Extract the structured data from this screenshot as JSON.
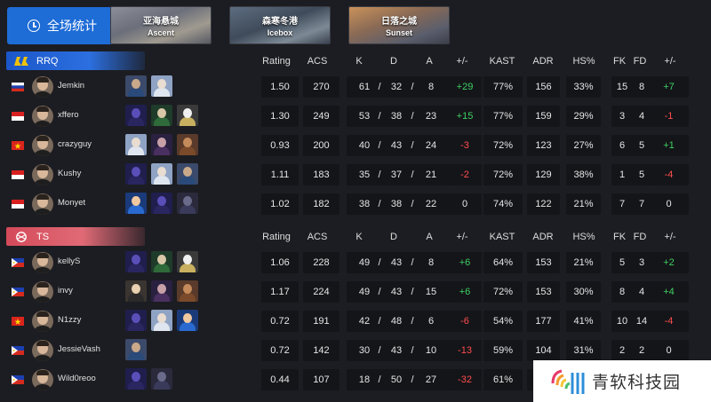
{
  "all_stats_label": "全场统计",
  "maps": [
    {
      "cn": "亚海悬城",
      "en": "Ascent"
    },
    {
      "cn": "森寒冬港",
      "en": "Icebox"
    },
    {
      "cn": "日落之城",
      "en": "Sunset"
    }
  ],
  "columns": [
    "Rating",
    "ACS",
    "K",
    "D",
    "A",
    "+/-",
    "KAST",
    "ADR",
    "HS%",
    "FK",
    "FD",
    "+/-"
  ],
  "teams": [
    {
      "name": "RRQ",
      "accent": "#2c6fe0",
      "players": [
        {
          "name": "Jemkin",
          "flag": "ru",
          "agents": [
            "sova",
            "jett"
          ],
          "rating": "1.50",
          "acs": "270",
          "k": "61",
          "d": "32",
          "a": "8",
          "kd_diff": "+29",
          "kast": "77%",
          "adr": "156",
          "hs": "33%",
          "fk": "15",
          "fd": "8",
          "fk_diff": "+7"
        },
        {
          "name": "xffero",
          "flag": "id",
          "agents": [
            "omen",
            "viper",
            "killjoy"
          ],
          "rating": "1.30",
          "acs": "249",
          "k": "53",
          "d": "38",
          "a": "23",
          "kd_diff": "+15",
          "kast": "77%",
          "adr": "159",
          "hs": "29%",
          "fk": "3",
          "fk_diff": "-1",
          "fd": "4"
        },
        {
          "name": "crazyguy",
          "flag": "vn",
          "agents": [
            "jett",
            "reyna",
            "breach"
          ],
          "rating": "0.93",
          "acs": "200",
          "k": "40",
          "d": "43",
          "a": "24",
          "kd_diff": "-3",
          "kast": "72%",
          "adr": "123",
          "hs": "27%",
          "fk": "6",
          "fd": "5",
          "fk_diff": "+1"
        },
        {
          "name": "Kushy",
          "flag": "id",
          "agents": [
            "omen",
            "jett",
            "sova"
          ],
          "rating": "1.11",
          "acs": "183",
          "k": "35",
          "d": "37",
          "a": "21",
          "kd_diff": "-2",
          "kast": "72%",
          "adr": "129",
          "hs": "38%",
          "fk": "1",
          "fd": "5",
          "fk_diff": "-4"
        },
        {
          "name": "Monyet",
          "flag": "id",
          "agents": [
            "neon",
            "omen",
            "omen2"
          ],
          "rating": "1.02",
          "acs": "182",
          "k": "38",
          "d": "38",
          "a": "22",
          "kd_diff": "0",
          "kast": "74%",
          "adr": "122",
          "hs": "21%",
          "fk": "7",
          "fd": "7",
          "fk_diff": "0"
        }
      ]
    },
    {
      "name": "TS",
      "accent": "#e06a76",
      "players": [
        {
          "name": "kellyS",
          "flag": "ph",
          "agents": [
            "omen",
            "viper",
            "killjoy"
          ],
          "rating": "1.06",
          "acs": "228",
          "k": "49",
          "d": "43",
          "a": "8",
          "kd_diff": "+6",
          "kast": "64%",
          "adr": "153",
          "hs": "21%",
          "fk": "5",
          "fd": "3",
          "fk_diff": "+2"
        },
        {
          "name": "invy",
          "flag": "ph",
          "agents": [
            "chamber",
            "reyna",
            "breach"
          ],
          "rating": "1.17",
          "acs": "224",
          "k": "49",
          "d": "43",
          "a": "15",
          "kd_diff": "+6",
          "kast": "72%",
          "adr": "153",
          "hs": "30%",
          "fk": "8",
          "fd": "4",
          "fk_diff": "+4"
        },
        {
          "name": "N1zzy",
          "flag": "vn",
          "agents": [
            "omen",
            "jett",
            "neon"
          ],
          "rating": "0.72",
          "acs": "191",
          "k": "42",
          "d": "48",
          "a": "6",
          "kd_diff": "-6",
          "kast": "54%",
          "adr": "177",
          "hs": "41%",
          "fk": "10",
          "fd": "14",
          "fk_diff": "-4"
        },
        {
          "name": "JessieVash",
          "flag": "ph",
          "agents": [
            "sova"
          ],
          "rating": "0.72",
          "acs": "142",
          "k": "30",
          "d": "43",
          "a": "10",
          "kd_diff": "-13",
          "kast": "59%",
          "adr": "104",
          "hs": "31%",
          "fk": "2",
          "fd": "2",
          "fk_diff": "0"
        },
        {
          "name": "Wild0reoo",
          "flag": "ph",
          "agents": [
            "omen",
            "omen2"
          ],
          "rating": "0.44",
          "acs": "107",
          "k": "18",
          "d": "50",
          "a": "27",
          "kd_diff": "-32",
          "kast": "61%",
          "adr": "",
          "hs": "",
          "fk": "",
          "fd": "",
          "fk_diff": ""
        }
      ]
    }
  ],
  "watermark": "青软科技园",
  "colors": {
    "positive": "#3fcf62",
    "negative": "#ff4d4d",
    "button": "#1e6cd6",
    "cell": "#141519",
    "background": "#1c1d22"
  }
}
